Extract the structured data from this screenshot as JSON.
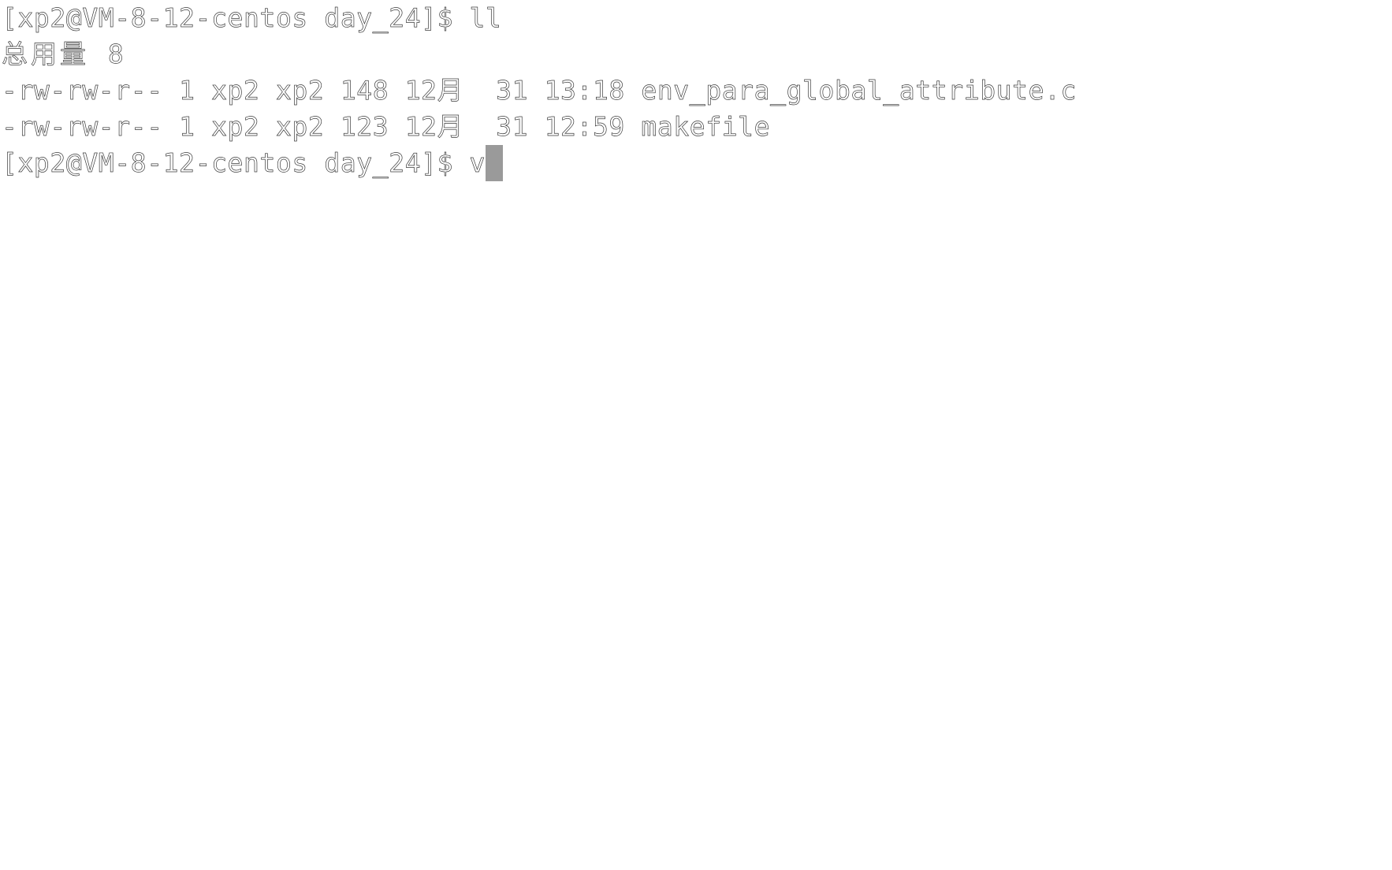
{
  "terminal": {
    "lines": {
      "prompt1": "[xp2@VM-8-12-centos day_24]$ ll",
      "total": "总用量 8",
      "file1": "-rw-rw-r-- 1 xp2 xp2 148 12月  31 13:18 env_para_global_attribute.c",
      "file2": "-rw-rw-r-- 1 xp2 xp2 123 12月  31 12:59 makefile",
      "prompt2": "[xp2@VM-8-12-centos day_24]$ v"
    },
    "cursor": {
      "style": "block",
      "color": "#9a9a9a"
    }
  }
}
